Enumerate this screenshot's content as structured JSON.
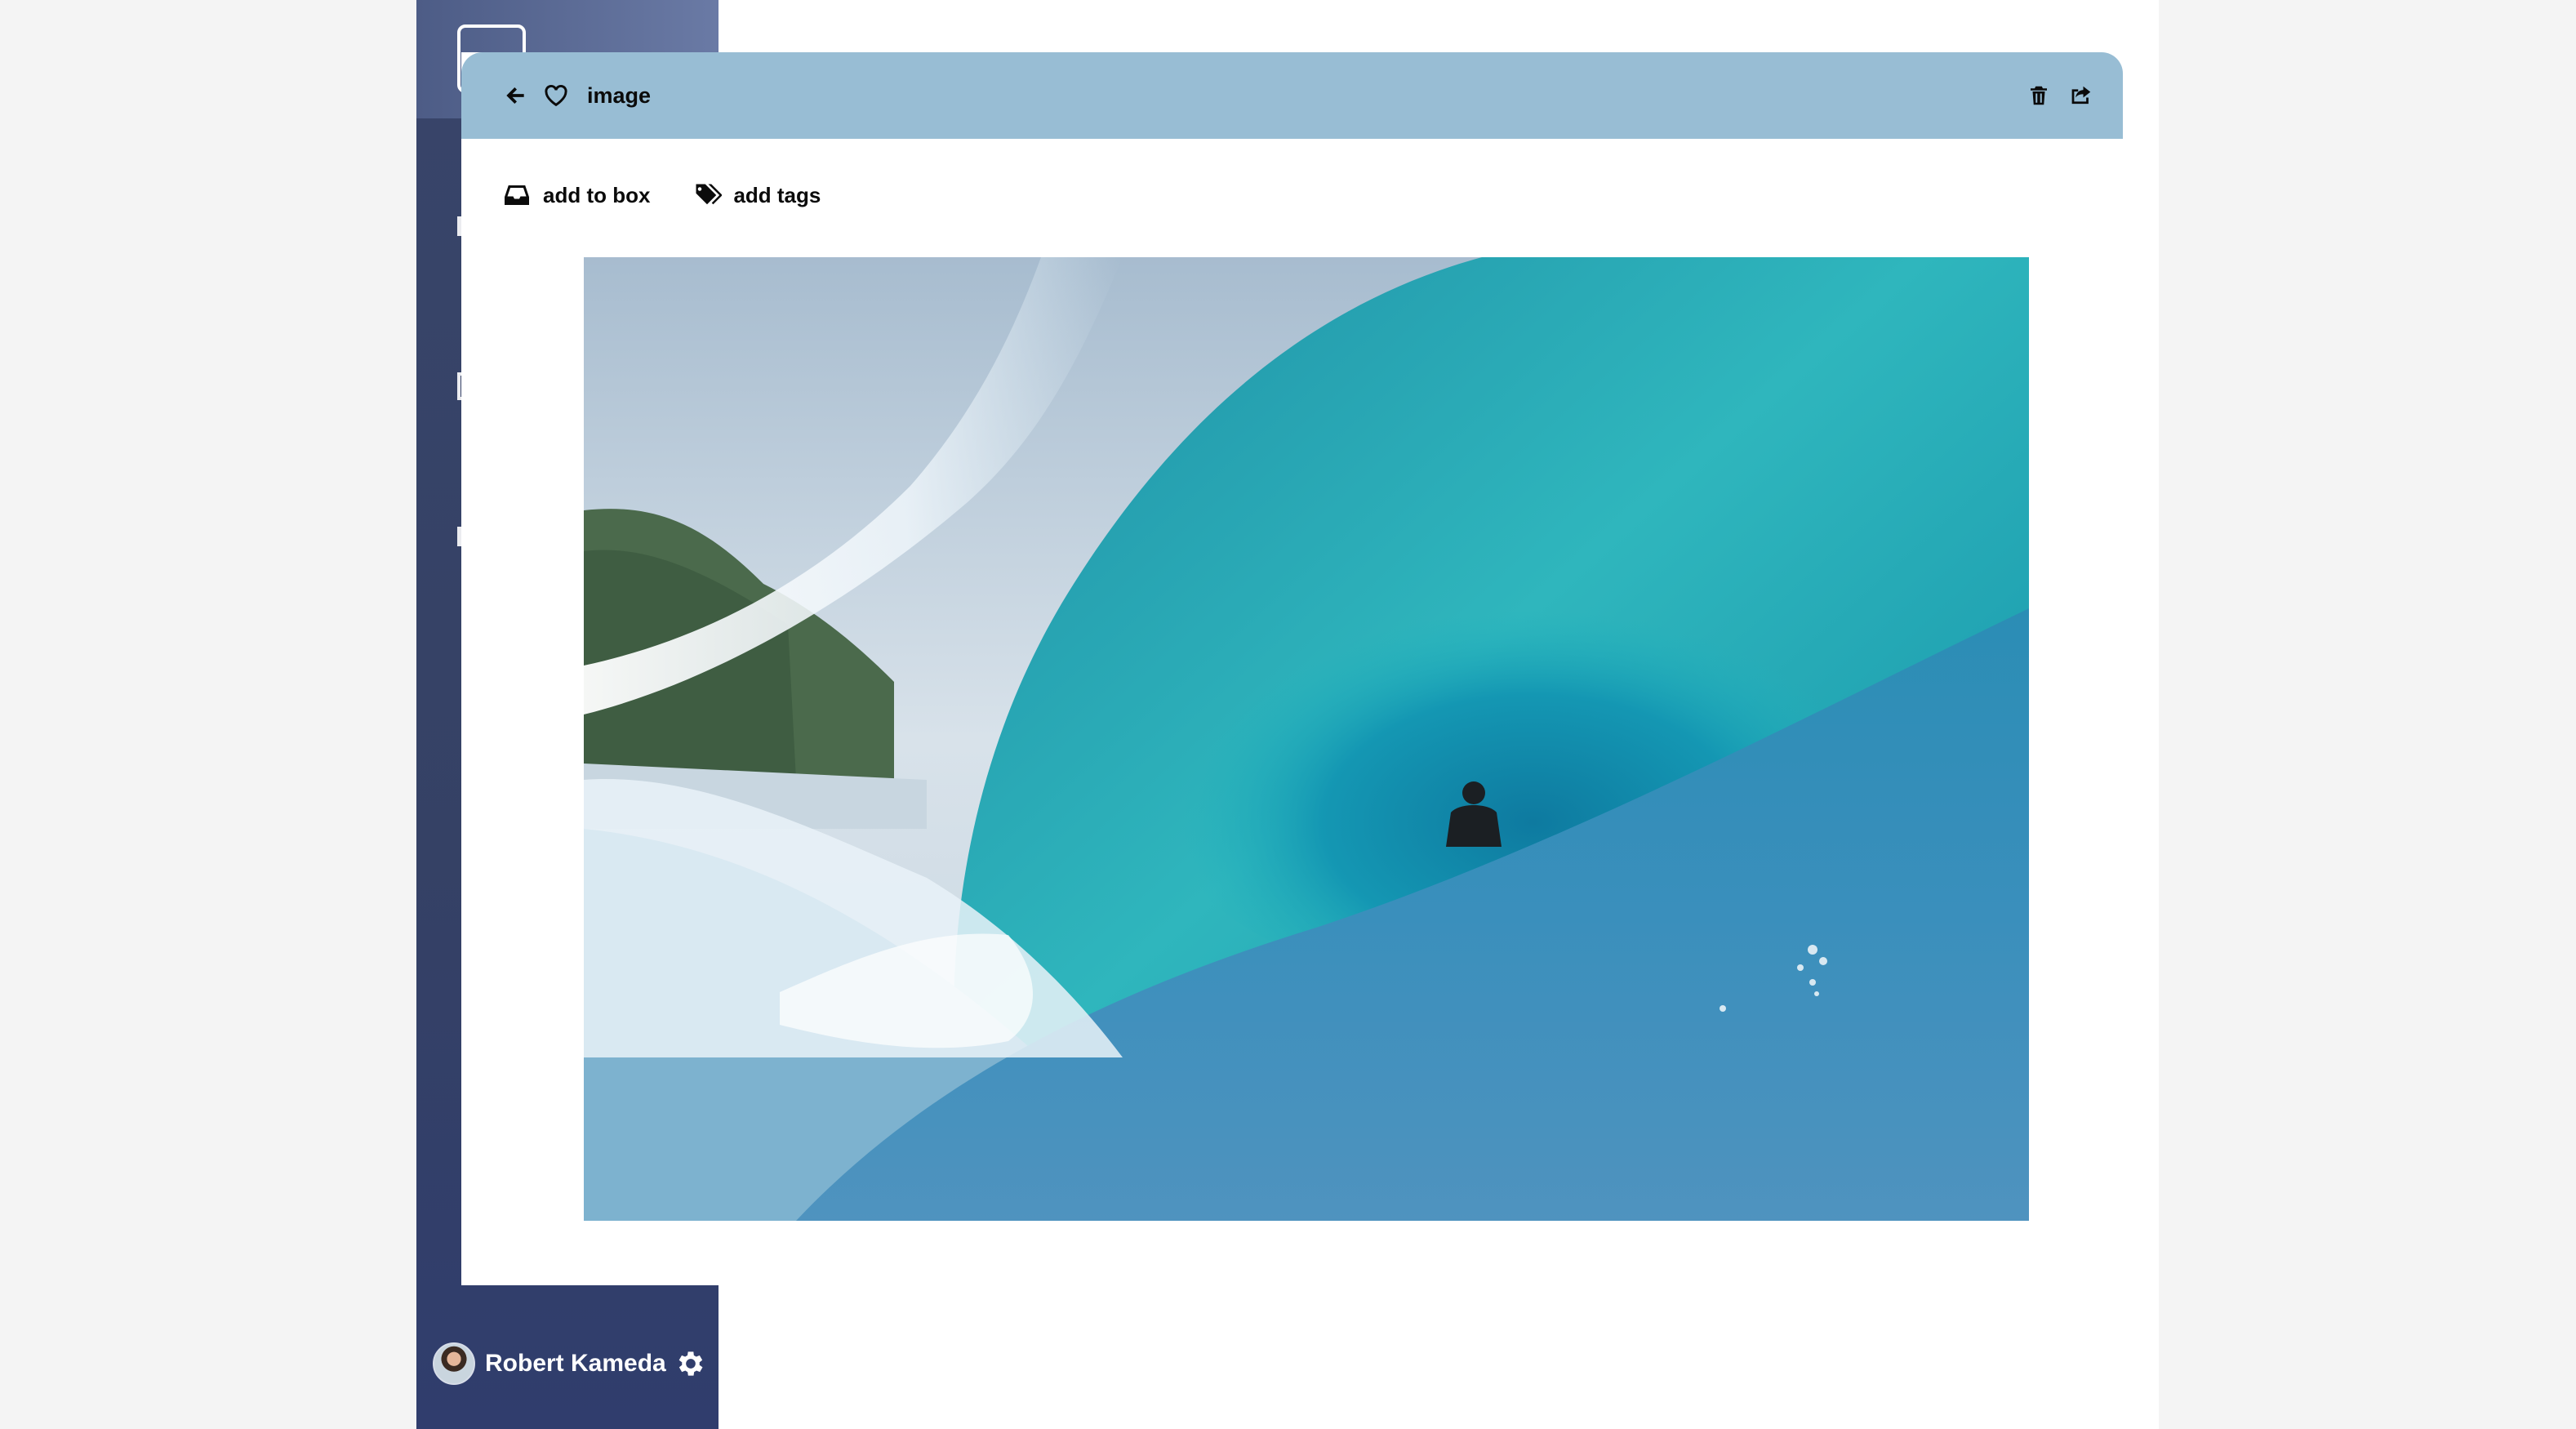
{
  "user": {
    "name": "Robert Kameda",
    "avatar_icon": "avatar-photo",
    "settings_icon": "gear-icon"
  },
  "modal": {
    "title": "image",
    "header_icons": [
      "back-arrow-icon",
      "heart-icon",
      "trash-icon",
      "share-icon"
    ],
    "actions": {
      "add_to_box": "add to box",
      "add_tags": "add tags"
    },
    "image_alt": "Surfer riding inside a turquoise barrel wave"
  },
  "colors": {
    "sidebar": "#38456a",
    "modal_header": "#98bdd4",
    "background": "#f4f4f4"
  }
}
